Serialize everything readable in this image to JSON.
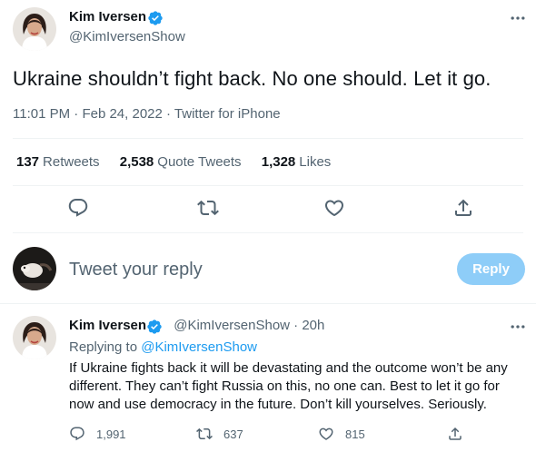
{
  "tweet": {
    "author_name": "Kim Iversen",
    "author_handle": "@KimIversenShow",
    "text": "Ukraine shouldn’t fight back. No one should. Let it go.",
    "time": "11:01 PM",
    "date": "Feb 24, 2022",
    "source": "Twitter for iPhone",
    "stats": [
      {
        "value": "137",
        "label": "Retweets"
      },
      {
        "value": "2,538",
        "label": "Quote Tweets"
      },
      {
        "value": "1,328",
        "label": "Likes"
      }
    ]
  },
  "composer": {
    "placeholder": "Tweet your reply",
    "button_label": "Reply"
  },
  "reply": {
    "author_name": "Kim Iversen",
    "author_handle": "@KimIversenShow",
    "age": "20h",
    "replying_prefix": "Replying to",
    "replying_to": "@KimIversenShow",
    "lines": [
      "If Ukraine fights back it will be devastating and the outcome won’t be any",
      "different. They can’t fight Russia on this, no one can. Best to let it go for",
      "now and use democracy in the future. Don’t kill yourselves. Seriously."
    ],
    "reply_count": "1,991",
    "retweet_count": "637",
    "like_count": "815"
  },
  "colors": {
    "accent": "#1d9bf0",
    "muted": "#536471",
    "reply_button_disabled": "#8ecdf8",
    "divider": "#eff3f4"
  },
  "icons": {
    "verified": "verified-badge-icon",
    "more": "more-horizontal-icon",
    "reply": "reply-bubble-icon",
    "retweet": "retweet-icon",
    "like": "heart-icon",
    "share": "share-upload-icon"
  }
}
